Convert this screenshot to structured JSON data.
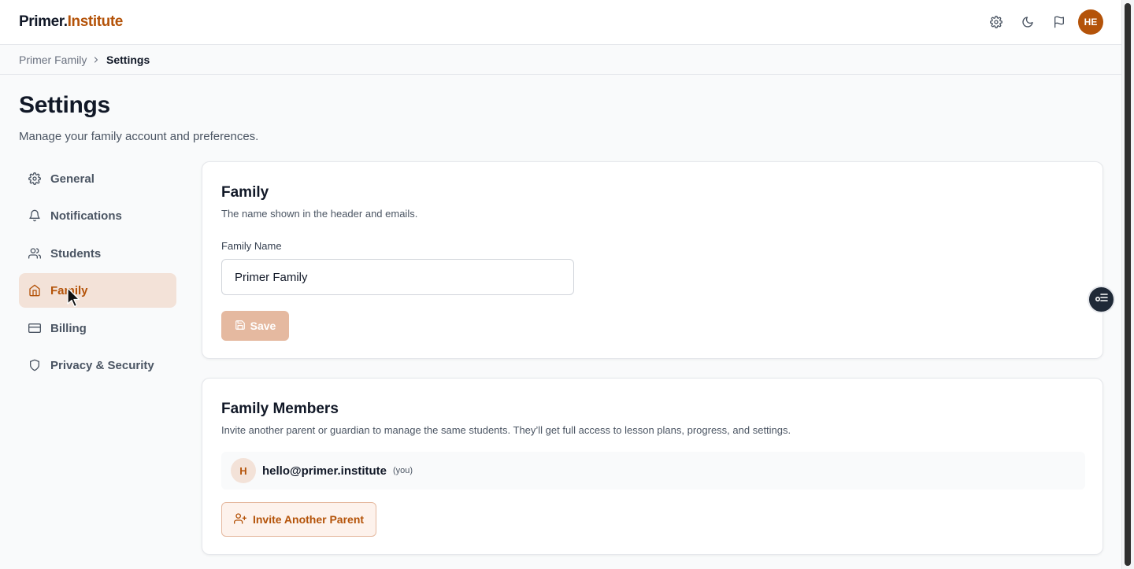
{
  "app": {
    "logo_part1": "Primer.",
    "logo_part2": "Institute",
    "avatar_initials": "HE",
    "top_icons": [
      "gear-icon",
      "moon-icon",
      "flag-icon"
    ]
  },
  "breadcrumb": {
    "items": [
      "Primer Family",
      "Settings"
    ]
  },
  "page": {
    "title": "Settings",
    "subtitle": "Manage your family account and preferences."
  },
  "sidebar": {
    "items": [
      {
        "label": "General",
        "icon": "gear-icon"
      },
      {
        "label": "Notifications",
        "icon": "bell-icon"
      },
      {
        "label": "Students",
        "icon": "users-icon"
      },
      {
        "label": "Family",
        "icon": "home-icon",
        "active": true
      },
      {
        "label": "Billing",
        "icon": "credit-card-icon"
      },
      {
        "label": "Privacy & Security",
        "icon": "shield-icon"
      }
    ]
  },
  "family_card": {
    "title": "Family",
    "description": "The name shown in the header and emails.",
    "field_label": "Family Name",
    "field_value": "Primer Family",
    "save_label": "Save"
  },
  "members_card": {
    "title": "Family Members",
    "description": "Invite another parent or guardian to manage the same students. They’ll get full access to lesson plans, progress, and settings.",
    "members": [
      {
        "initial": "H",
        "email": "hello@primer.institute",
        "tag": "(you)"
      }
    ],
    "invite_label": "Invite Another Parent"
  },
  "colors": {
    "accent": "#b45309",
    "accent_soft": "#f3e2d8",
    "save_disabled": "#e5b9a0"
  }
}
